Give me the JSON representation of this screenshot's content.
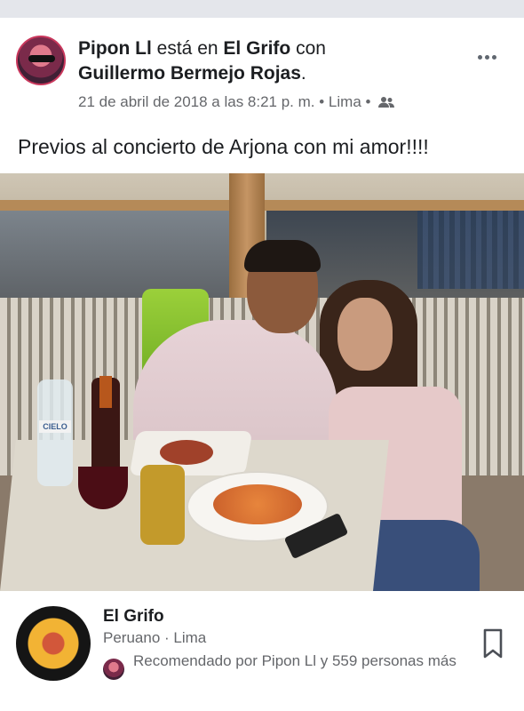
{
  "post": {
    "author": "Pipon Ll",
    "verb_is_at": "está en",
    "place": "El Grifo",
    "with_word": "con",
    "tagged": "Guillermo Bermejo Rojas",
    "tagged_period": ".",
    "timestamp": "21 de abril de 2018 a las 8:21 p. m.",
    "separator": " • ",
    "location": "Lima",
    "audience_icon": "friends-icon",
    "text": "Previos al concierto de Arjona con mi amor!!!!"
  },
  "photo": {
    "bottle_label": "CIELO"
  },
  "place_card": {
    "name": "El Grifo",
    "subtitle": "Peruano · Lima",
    "recommendation": "Recomendado por Pipon Ll y 559 personas más",
    "logo_colors": [
      "#151515",
      "#f2b334",
      "#d2573a"
    ]
  },
  "colors": {
    "text_primary": "#1c1e21",
    "text_secondary": "#65676b",
    "topbar": "#e4e6eb"
  }
}
